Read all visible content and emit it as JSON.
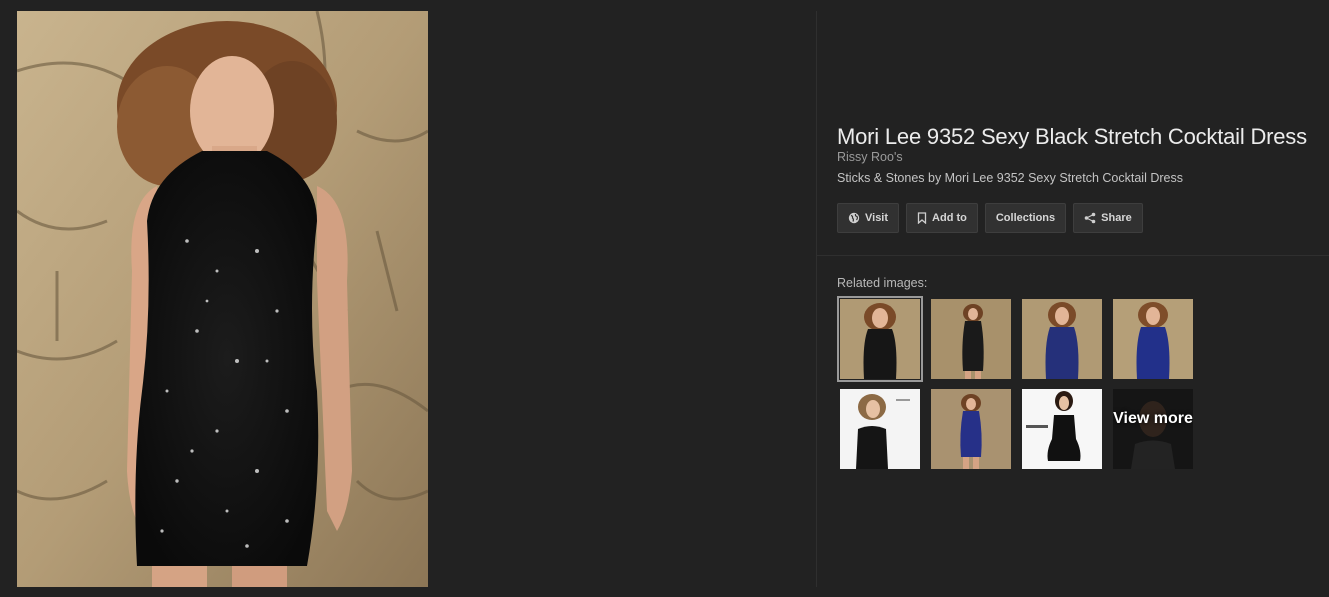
{
  "detail": {
    "title": "Mori Lee 9352 Sexy Black Stretch Cocktail Dress",
    "source": "Rissy Roo's",
    "description": "Sticks & Stones by Mori Lee 9352 Sexy Stretch Cocktail Dress"
  },
  "actions": {
    "visit": "Visit",
    "add_to": "Add to",
    "collections": "Collections",
    "share": "Share"
  },
  "related": {
    "label": "Related images:",
    "view_more": "View more"
  },
  "colors": {
    "background": "#222222",
    "button_bg": "#313131",
    "text_primary": "#ececec",
    "text_secondary": "#9a9a9a"
  }
}
